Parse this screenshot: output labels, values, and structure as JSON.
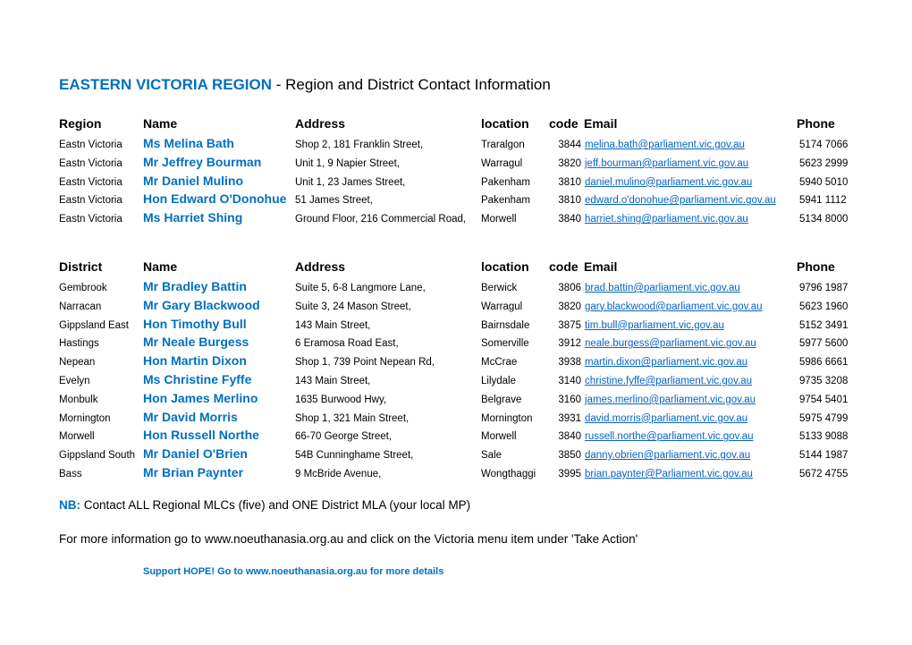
{
  "title": {
    "accent": "EASTERN VICTORIA REGION",
    "rest": " - Region and District Contact Information"
  },
  "colors": {
    "accent": "#0070c0",
    "link": "#0563c1"
  },
  "region_table": {
    "headers": {
      "region": "Region",
      "name": "Name",
      "address": "Address",
      "location": "location",
      "code": "code",
      "email": "Email",
      "phone": "Phone"
    },
    "rows": [
      {
        "region": "Eastn Victoria",
        "name": "Ms Melina Bath",
        "address": "Shop 2, 181 Franklin Street,",
        "location": "Traralgon",
        "code": "3844",
        "email": "melina.bath@parliament.vic.gov.au",
        "phone": "5174 7066"
      },
      {
        "region": "Eastn Victoria",
        "name": "Mr Jeffrey Bourman",
        "address": "Unit 1, 9 Napier Street,",
        "location": "Warragul",
        "code": "3820",
        "email": "jeff.bourman@parliament.vic.gov.au",
        "phone": "5623 2999"
      },
      {
        "region": "Eastn Victoria",
        "name": "Mr Daniel Mulino",
        "address": "Unit 1, 23 James Street,",
        "location": "Pakenham",
        "code": "3810",
        "email": "daniel.mulino@parliament.vic.gov.au",
        "phone": "5940 5010"
      },
      {
        "region": "Eastn Victoria",
        "name": "Hon Edward O'Donohue",
        "address": "51 James Street,",
        "location": "Pakenham",
        "code": "3810",
        "email": "edward.o'donohue@parliament.vic.gov.au",
        "phone": "5941 1112"
      },
      {
        "region": "Eastn Victoria",
        "name": "Ms Harriet Shing",
        "address": "Ground Floor, 216 Commercial Road,",
        "location": "Morwell",
        "code": "3840",
        "email": "harriet.shing@parliament.vic.gov.au",
        "phone": "5134 8000"
      }
    ]
  },
  "district_table": {
    "headers": {
      "district": "District",
      "name": "Name",
      "address": "Address",
      "location": "location",
      "code": "code",
      "email": "Email",
      "phone": "Phone"
    },
    "rows": [
      {
        "district": "Gembrook",
        "name": "Mr Bradley Battin",
        "address": "Suite 5, 6-8 Langmore Lane,",
        "location": "Berwick",
        "code": "3806",
        "email": "brad.battin@parliament.vic.gov.au",
        "phone": "9796 1987"
      },
      {
        "district": "Narracan",
        "name": "Mr Gary Blackwood",
        "address": "Suite 3, 24 Mason Street,",
        "location": "Warragul",
        "code": "3820",
        "email": "gary.blackwood@parliament.vic.gov.au",
        "phone": "5623 1960"
      },
      {
        "district": "Gippsland East",
        "name": "Hon Timothy Bull",
        "address": "143 Main Street,",
        "location": "Bairnsdale",
        "code": "3875",
        "email": "tim.bull@parliament.vic.gov.au",
        "phone": "5152 3491"
      },
      {
        "district": "Hastings",
        "name": "Mr Neale Burgess",
        "address": "6 Eramosa Road East,",
        "location": "Somerville",
        "code": "3912",
        "email": "neale.burgess@parliament.vic.gov.au",
        "phone": "5977 5600"
      },
      {
        "district": "Nepean",
        "name": "Hon Martin Dixon",
        "address": "Shop 1, 739 Point Nepean Rd,",
        "location": "McCrae",
        "code": "3938",
        "email": "martin.dixon@parliament.vic.gov.au",
        "phone": "5986 6661"
      },
      {
        "district": "Evelyn",
        "name": "Ms Christine Fyffe",
        "address": "143 Main Street,",
        "location": "Lilydale",
        "code": "3140",
        "email": "christine.fyffe@parliament.vic.gov.au",
        "phone": "9735 3208"
      },
      {
        "district": "Monbulk",
        "name": "Hon James Merlino",
        "address": "1635 Burwood Hwy,",
        "location": "Belgrave",
        "code": "3160",
        "email": "james.merlino@parliament.vic.gov.au",
        "phone": "9754 5401"
      },
      {
        "district": "Mornington",
        "name": "Mr David Morris",
        "address": "Shop 1, 321 Main Street,",
        "location": "Mornington",
        "code": "3931",
        "email": "david.morris@parliament.vic.gov.au",
        "phone": "5975 4799"
      },
      {
        "district": "Morwell",
        "name": "Hon Russell Northe",
        "address": "66-70 George Street,",
        "location": "Morwell",
        "code": "3840",
        "email": "russell.northe@parliament.vic.gov.au",
        "phone": "5133 9088"
      },
      {
        "district": "Gippsland South",
        "name": "Mr Daniel O'Brien",
        "address": "54B Cunninghame Street,",
        "location": "Sale",
        "code": "3850",
        "email": "danny.obrien@parliament.vic.gov.au",
        "phone": "5144 1987"
      },
      {
        "district": "Bass",
        "name": "Mr Brian Paynter",
        "address": "9 McBride Avenue,",
        "location": "Wongthaggi",
        "code": "3995",
        "email": "brian.paynter@Parliament.vic.gov.au",
        "phone": "5672 4755"
      }
    ]
  },
  "notes": {
    "nb_label": "NB:",
    "nb_text": " Contact ALL Regional MLCs (five) and ONE District MLA (your local MP)",
    "info_text": "For more information go to www.noeuthanasia.org.au and click on the Victoria menu item under 'Take Action'",
    "support_text": "Support HOPE! Go to www.noeuthanasia.org.au for more details"
  }
}
